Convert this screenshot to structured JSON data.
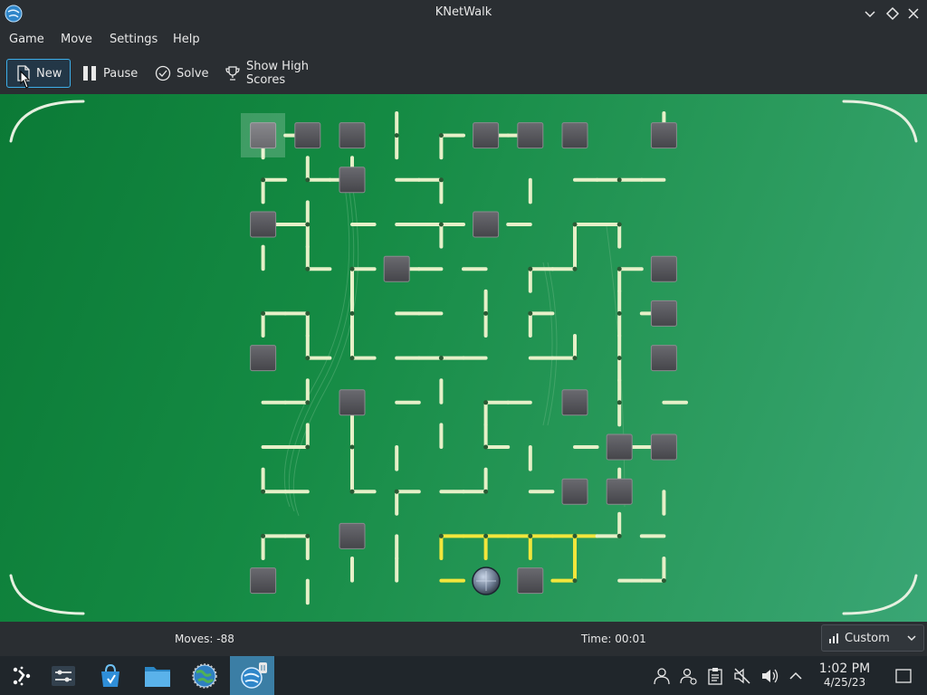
{
  "window": {
    "title": "KNetWalk"
  },
  "menu": {
    "items": [
      "Game",
      "Move",
      "Settings",
      "Help"
    ]
  },
  "toolbar": {
    "new_label": "New",
    "pause_label": "Pause",
    "solve_label": "Solve",
    "scores_label": "Show High Scores"
  },
  "status": {
    "moves": "Moves: -88",
    "time": "Time: 00:01",
    "difficulty": "Custom"
  },
  "clock": {
    "time": "1:02 PM",
    "date": "4/25/23"
  },
  "colors": {
    "board_green": "#148a43",
    "wire": "#e6f0c8",
    "wire_active": "#f2e63c",
    "terminal": "#5a5a5e",
    "accent": "#3daee9"
  },
  "taskbar": {
    "apps": [
      "application-launcher-icon",
      "system-settings-icon",
      "discover-store-icon",
      "file-manager-icon",
      "browser-icon",
      "knetwalk-icon"
    ]
  },
  "tray": {
    "icons": [
      "user-icon",
      "user-switch-icon",
      "clipboard-icon",
      "speaker-muted-icon",
      "volume-icon",
      "expand-tray-icon",
      "show-desktop-icon"
    ]
  }
}
